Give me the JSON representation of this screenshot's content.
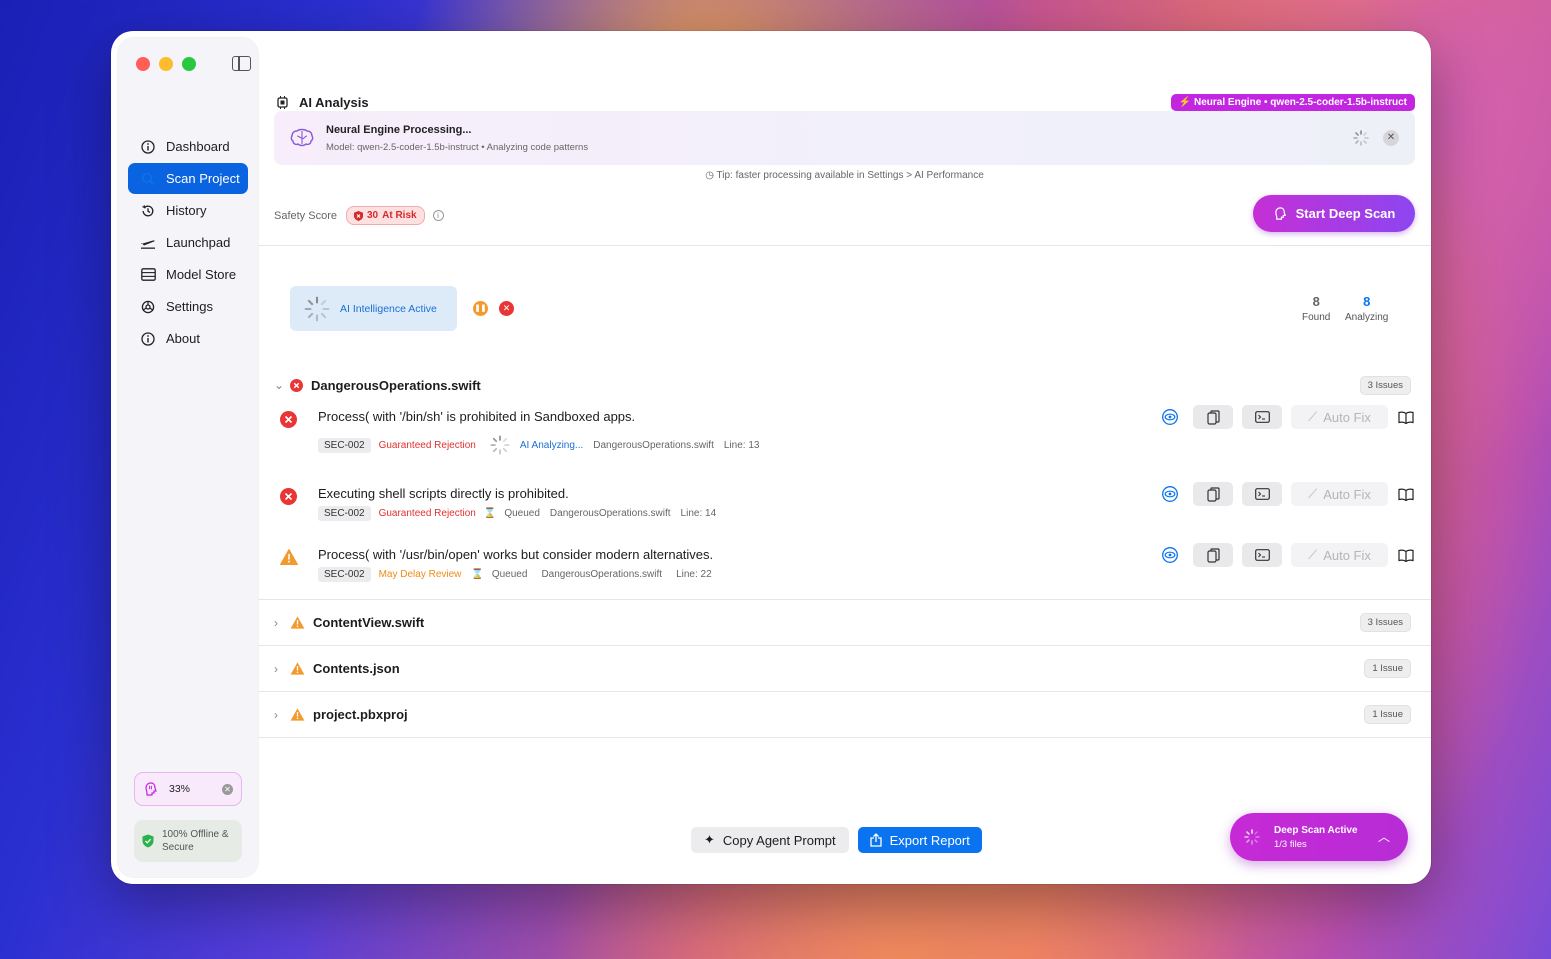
{
  "sidebar": {
    "items": [
      {
        "label": "Dashboard",
        "icon": "info-circle-icon"
      },
      {
        "label": "Scan Project",
        "icon": "search-icon"
      },
      {
        "label": "History",
        "icon": "history-icon"
      },
      {
        "label": "Launchpad",
        "icon": "airplane-icon"
      },
      {
        "label": "Model Store",
        "icon": "database-icon"
      },
      {
        "label": "Settings",
        "icon": "gear-icon"
      },
      {
        "label": "About",
        "icon": "info-icon"
      }
    ],
    "active_index": 1,
    "progress_label": "33%",
    "offline_label": "100% Offline & Secure"
  },
  "header": {
    "title": "AI Analysis",
    "engine_badge": "Neural Engine • qwen-2.5-coder-1.5b-instruct"
  },
  "processing": {
    "title": "Neural Engine Processing...",
    "detail": "Model: qwen-2.5-coder-1.5b-instruct  • Analyzing code patterns"
  },
  "tip": "Tip: faster processing available in Settings > AI Performance",
  "safety": {
    "label": "Safety Score",
    "score": "30",
    "status": "At Risk"
  },
  "deep_scan_button": "Start Deep Scan",
  "ai_status": "AI Intelligence Active",
  "stats": {
    "found": {
      "value": "8",
      "label": "Found"
    },
    "analyzing": {
      "value": "8",
      "label": "Analyzing"
    }
  },
  "files": [
    {
      "name": "DangerousOperations.swift",
      "count": "3 Issues",
      "expanded": true,
      "issues": [
        {
          "message": "Process( with '/bin/sh' is prohibited in Sandboxed apps.",
          "code": "SEC-002",
          "severity": "Guaranteed Rejection",
          "status": "AI Analyzing...",
          "file": "DangerousOperations.swift",
          "line": "Line: 13"
        },
        {
          "message": "Executing shell scripts directly is prohibited.",
          "code": "SEC-002",
          "severity": "Guaranteed Rejection",
          "status": "Queued",
          "file": "DangerousOperations.swift",
          "line": "Line: 14"
        },
        {
          "message": "Process( with '/usr/bin/open' works but consider modern alternatives.",
          "code": "SEC-002",
          "severity": "May Delay Review",
          "status": "Queued",
          "file": "DangerousOperations.swift",
          "line": "Line: 22"
        }
      ]
    },
    {
      "name": "ContentView.swift",
      "count": "3 Issues",
      "expanded": false
    },
    {
      "name": "Contents.json",
      "count": "1 Issue",
      "expanded": false
    },
    {
      "name": "project.pbxproj",
      "count": "1 Issue",
      "expanded": false
    }
  ],
  "actions": {
    "auto_fix": "Auto Fix"
  },
  "bottom": {
    "copy_prompt": "Copy Agent Prompt",
    "export_report": "Export Report"
  },
  "deep_scan_status": {
    "title": "Deep Scan Active",
    "progress": "1/3 files"
  },
  "colors": {
    "accent": "#0a63e0",
    "danger": "#e93535",
    "warning": "#f39a2e",
    "ai_purple": "#c226e0"
  }
}
